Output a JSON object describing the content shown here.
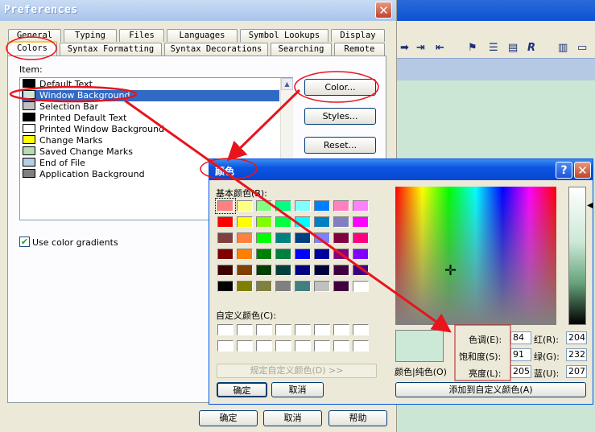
{
  "pref": {
    "title": "Preferences",
    "tabs_row1": [
      "General",
      "Typing",
      "Files",
      "Languages",
      "Symbol Lookups",
      "Display"
    ],
    "tabs_row2": [
      "Colors",
      "Syntax Formatting",
      "Syntax Decorations",
      "Searching",
      "Remote"
    ],
    "item_label": "Item:",
    "items": [
      {
        "label": "Default Text",
        "color": "#000000"
      },
      {
        "label": "Window Background",
        "color": "#cce6d6"
      },
      {
        "label": "Selection Bar",
        "color": "#c0c0c0"
      },
      {
        "label": "Printed Default Text",
        "color": "#000000"
      },
      {
        "label": "Printed Window Background",
        "color": "#ffffff"
      },
      {
        "label": "Change Marks",
        "color": "#ffff00"
      },
      {
        "label": "Saved Change Marks",
        "color": "#b8dcb0"
      },
      {
        "label": "End of File",
        "color": "#b4cfe6"
      },
      {
        "label": "Application Background",
        "color": "#808080"
      }
    ],
    "color_button": "Color...",
    "styles_button": "Styles...",
    "reset_button": "Reset...",
    "gradients_label": "Use color gradients",
    "gradients_checked": true,
    "ok": "确定",
    "cancel": "取消",
    "help": "帮助",
    "close_glyph": "✕"
  },
  "color_dialog": {
    "title": "颜色",
    "help_glyph": "?",
    "close_glyph": "✕",
    "basic_colors_label": "基本颜色(B):",
    "basic_colors": [
      "#ff8080",
      "#ffff80",
      "#80ff80",
      "#00ff80",
      "#80ffff",
      "#0080ff",
      "#ff80c0",
      "#ff80ff",
      "#ff0000",
      "#ffff00",
      "#80ff00",
      "#00ff40",
      "#00ffff",
      "#0080c0",
      "#8080c0",
      "#ff00ff",
      "#804040",
      "#ff8040",
      "#00ff00",
      "#008080",
      "#004080",
      "#8080ff",
      "#800040",
      "#ff0080",
      "#800000",
      "#ff8000",
      "#008000",
      "#008040",
      "#0000ff",
      "#0000a0",
      "#800080",
      "#8000ff",
      "#400000",
      "#804000",
      "#004000",
      "#004040",
      "#000080",
      "#000040",
      "#400040",
      "#400080",
      "#000000",
      "#808000",
      "#808040",
      "#808080",
      "#408080",
      "#c0c0c0",
      "#400040",
      "#ffffff"
    ],
    "custom_colors_label": "自定义颜色(C):",
    "define_custom": "规定自定义颜色(D) >>",
    "ok": "确定",
    "cancel": "取消",
    "preview_label": "颜色|纯色(O)",
    "preview_color": "#cce8d7",
    "hue_label": "色调(E):",
    "hue": "84",
    "sat_label": "饱和度(S):",
    "sat": "91",
    "lum_label": "亮度(L):",
    "lum": "205",
    "red_label": "红(R):",
    "red": "204",
    "green_label": "绿(G):",
    "green": "232",
    "blue_label": "蓝(U):",
    "blue": "207",
    "add_custom": "添加到自定义颜色(A)"
  },
  "editor": {
    "toolbar_icons": [
      "arrow-right-icon",
      "indent-icon",
      "outdent-icon",
      "bookmark-icon",
      "bookmark-list-icon",
      "book-icon",
      "reference-icon",
      "split-window-icon",
      "window-icon"
    ]
  }
}
